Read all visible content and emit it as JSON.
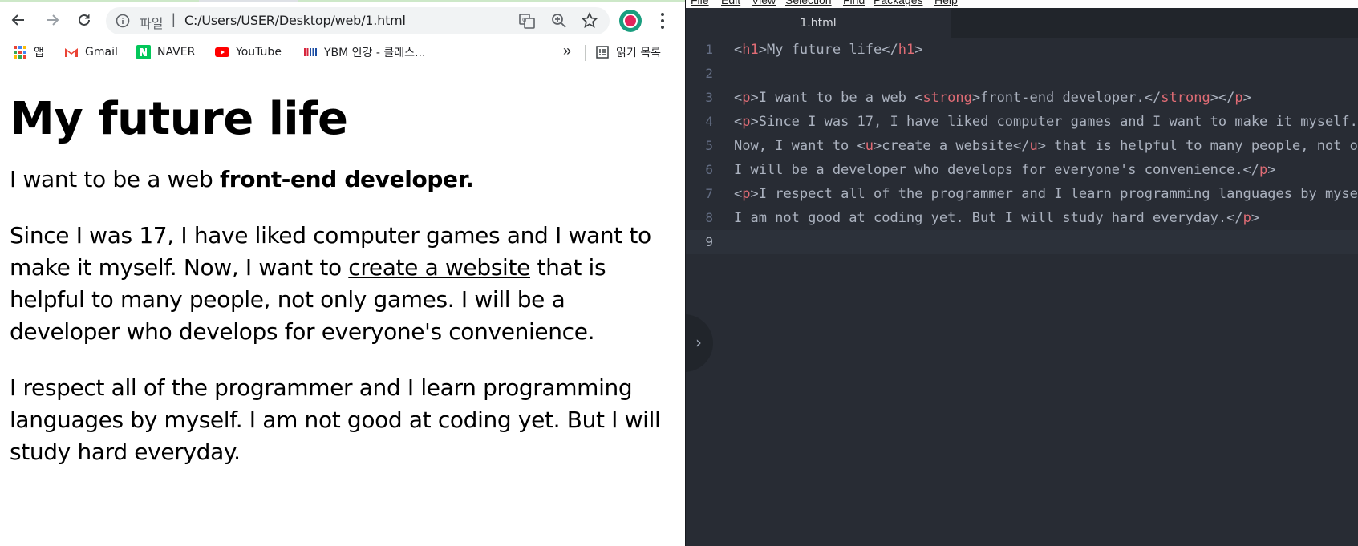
{
  "browser": {
    "omnibox": {
      "scheme_label": "파일",
      "separator": "|",
      "url": "C:/Users/USER/Desktop/web/1.html"
    },
    "bookmarks": [
      {
        "label": "앱",
        "icon": "apps-grid-icon"
      },
      {
        "label": "Gmail",
        "icon": "gmail-icon"
      },
      {
        "label": "NAVER",
        "icon": "naver-icon"
      },
      {
        "label": "YouTube",
        "icon": "youtube-icon"
      },
      {
        "label": "YBM 인강 - 클래스...",
        "icon": "ybm-icon"
      }
    ],
    "more_label": "»",
    "reading_list_label": "읽기 목록",
    "page": {
      "h1": "My future life",
      "p1_text": "I want to be a web ",
      "p1_strong": "front-end developer.",
      "p2_before": "Since I was 17, I have liked computer games and I want to make it myself. Now, I want to ",
      "p2_underline": "create a website",
      "p2_after": " that is helpful to many people, not only games. I will be a developer who develops for everyone's convenience.",
      "p3": "I respect all of the programmer and I learn programming languages by myself. I am not good at coding yet. But I will study hard everyday."
    },
    "colors": {
      "profile_ring": "#1a9e7f",
      "profile_fill": "#e4245c"
    }
  },
  "editor": {
    "menu": [
      "File",
      "Edit",
      "View",
      "Selection",
      "Find",
      "Packages",
      "Help"
    ],
    "tab_title": "1.html",
    "gutter_toggle": "›",
    "lines": [
      {
        "n": "1",
        "segs": [
          [
            "p",
            "<"
          ],
          [
            "t",
            "h1"
          ],
          [
            "p",
            ">My future life</"
          ],
          [
            "t",
            "h1"
          ],
          [
            "p",
            ">"
          ]
        ]
      },
      {
        "n": "2",
        "segs": []
      },
      {
        "n": "3",
        "segs": [
          [
            "p",
            "<"
          ],
          [
            "t",
            "p"
          ],
          [
            "p",
            ">I want to be a web <"
          ],
          [
            "t",
            "strong"
          ],
          [
            "p",
            ">front-end developer.</"
          ],
          [
            "t",
            "strong"
          ],
          [
            "p",
            "></"
          ],
          [
            "t",
            "p"
          ],
          [
            "p",
            ">"
          ]
        ]
      },
      {
        "n": "4",
        "segs": [
          [
            "p",
            "<"
          ],
          [
            "t",
            "p"
          ],
          [
            "p",
            ">Since I was 17, I have liked computer games and I want to make it myself."
          ]
        ]
      },
      {
        "n": "5",
        "segs": [
          [
            "p",
            "Now, I want to <"
          ],
          [
            "t",
            "u"
          ],
          [
            "p",
            ">create a website</"
          ],
          [
            "t",
            "u"
          ],
          [
            "p",
            "> that is helpful to many people, not only games."
          ]
        ]
      },
      {
        "n": "6",
        "segs": [
          [
            "p",
            "I will be a developer who develops for everyone's convenience.</"
          ],
          [
            "t",
            "p"
          ],
          [
            "p",
            ">"
          ]
        ]
      },
      {
        "n": "7",
        "segs": [
          [
            "p",
            "<"
          ],
          [
            "t",
            "p"
          ],
          [
            "p",
            ">I respect all of the programmer and I learn programming languages by myself."
          ]
        ]
      },
      {
        "n": "8",
        "segs": [
          [
            "p",
            "I am not good at coding yet. But I will study hard everyday.</"
          ],
          [
            "t",
            "p"
          ],
          [
            "p",
            ">"
          ]
        ]
      },
      {
        "n": "9",
        "segs": []
      }
    ],
    "cursor_line": 9,
    "colors": {
      "background": "#282c34",
      "tag": "#e06c75",
      "text": "#abb2bf",
      "line_number": "#636d83"
    }
  }
}
